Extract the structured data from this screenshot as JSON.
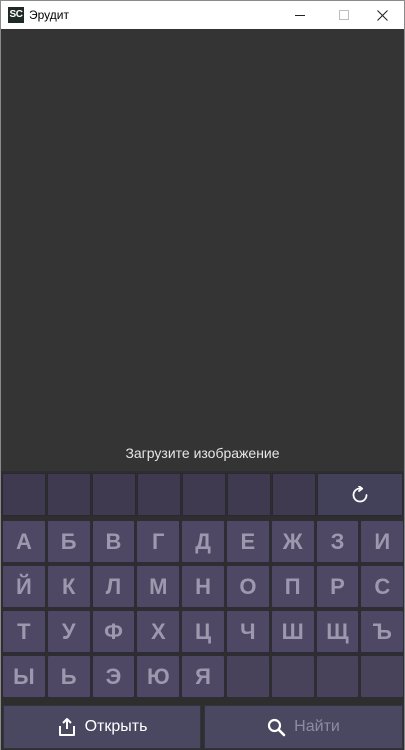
{
  "window": {
    "title": "Эрудит",
    "icon_text": "SC"
  },
  "image_area": {
    "hint": "Загрузите изображение"
  },
  "slots": {
    "count": 7,
    "reset_icon": "refresh-icon"
  },
  "keyboard": {
    "rows": [
      [
        "А",
        "Б",
        "В",
        "Г",
        "Д",
        "Е",
        "Ж",
        "З",
        "И"
      ],
      [
        "Й",
        "К",
        "Л",
        "М",
        "Н",
        "О",
        "П",
        "Р",
        "С"
      ],
      [
        "Т",
        "У",
        "Ф",
        "Х",
        "Ц",
        "Ч",
        "Ш",
        "Щ",
        "Ъ"
      ],
      [
        "Ы",
        "Ь",
        "Э",
        "Ю",
        "Я",
        "",
        "",
        "",
        ""
      ]
    ]
  },
  "actions": {
    "open_label": "Открыть",
    "open_icon": "upload-icon",
    "find_label": "Найти",
    "find_icon": "search-icon"
  },
  "colors": {
    "background": "#343434",
    "key": "#4e4864",
    "key_text": "#9c98ae",
    "slot": "#3f3a4f"
  }
}
